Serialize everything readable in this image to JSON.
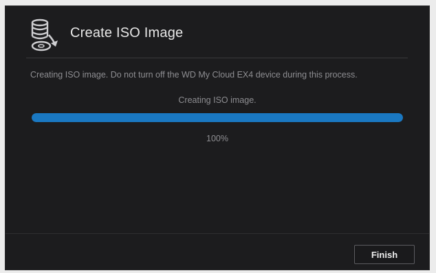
{
  "dialog": {
    "title": "Create ISO Image",
    "title_icon": "disc-image-create-icon",
    "message": "Creating ISO image. Do not turn off the WD My Cloud EX4 device during this process.",
    "status": "Creating ISO image.",
    "progress": {
      "percent_label": "100%",
      "value": 1.0
    },
    "finish_label": "Finish"
  },
  "colors": {
    "dialog_bg": "#1c1c1e",
    "accent": "#1a78c2",
    "text_primary": "#e8e8e8",
    "text_secondary": "#8e8e92"
  }
}
